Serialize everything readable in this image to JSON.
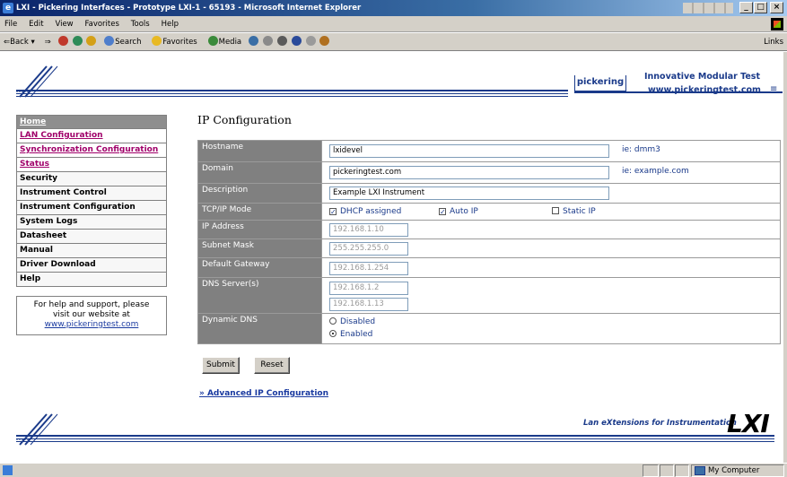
{
  "window": {
    "title": "LXI - Pickering Interfaces - Prototype LXI-1 - 65193 - Microsoft Internet Explorer",
    "min_glyph": "_",
    "max_glyph": "□",
    "close_glyph": "×"
  },
  "menubar": [
    "File",
    "Edit",
    "View",
    "Favorites",
    "Tools",
    "Help"
  ],
  "toolbar": {
    "back": "⇐Back",
    "back_arrow": "▾",
    "forward": "⇒",
    "search": "Search",
    "favorites": "Favorites",
    "media": "Media",
    "links": "Links"
  },
  "header": {
    "brand": "pickering",
    "tagline": "Innovative Modular Test",
    "url": "www.pickeringtest.com",
    "menu_glyph": "≡"
  },
  "nav": [
    {
      "label": "Home",
      "style": "active"
    },
    {
      "label": "LAN Configuration",
      "style": "link"
    },
    {
      "label": "Synchronization Configuration",
      "style": "link"
    },
    {
      "label": "Status",
      "style": "link"
    },
    {
      "label": "Security",
      "style": "plain"
    },
    {
      "label": "Instrument Control",
      "style": "plain"
    },
    {
      "label": "Instrument Configuration",
      "style": "plain"
    },
    {
      "label": "System Logs",
      "style": "plain"
    },
    {
      "label": "Datasheet",
      "style": "plain"
    },
    {
      "label": "Manual",
      "style": "plain"
    },
    {
      "label": "Driver Download",
      "style": "plain"
    },
    {
      "label": "Help",
      "style": "plain"
    }
  ],
  "help_box": {
    "line1": "For help and support, please",
    "line2": "visit our website at",
    "link": "www.pickeringtest.com"
  },
  "main": {
    "title": "IP Configuration",
    "hostname": {
      "label": "Hostname",
      "value": "lxidevel",
      "hint": "ie: dmm3"
    },
    "domain": {
      "label": "Domain",
      "value": "pickeringtest.com",
      "hint": "ie: example.com"
    },
    "description": {
      "label": "Description",
      "value": "Example LXI Instrument"
    },
    "tcpip": {
      "label": "TCP/IP Mode",
      "dhcp": "DHCP assigned",
      "dhcp_checked": true,
      "autoip": "Auto IP",
      "autoip_checked": true,
      "static": "Static IP",
      "static_checked": false,
      "check_glyph": "✓"
    },
    "ip_address": {
      "label": "IP Address",
      "value": "192.168.1.10"
    },
    "subnet": {
      "label": "Subnet Mask",
      "value": "255.255.255.0"
    },
    "gateway": {
      "label": "Default Gateway",
      "value": "192.168.1.254"
    },
    "dns": {
      "label": "DNS Server(s)",
      "values": [
        "192.168.1.2",
        "192.168.1.13"
      ]
    },
    "dyndns": {
      "label": "Dynamic DNS",
      "options": [
        "Disabled",
        "Enabled"
      ],
      "selected": "Enabled"
    },
    "submit_label": "Submit",
    "reset_label": "Reset",
    "advanced_link": "» Advanced IP Configuration"
  },
  "footer": {
    "tagline": "Lan eXtensions for Instrumentation",
    "logo": "LXI"
  },
  "statusbar": {
    "zone": "My Computer"
  },
  "colors": {
    "brand_navy": "#1a3a8a",
    "label_bg": "#808080",
    "nav_active_bg": "#8e8e8e",
    "nav_link": "#a0006a"
  }
}
